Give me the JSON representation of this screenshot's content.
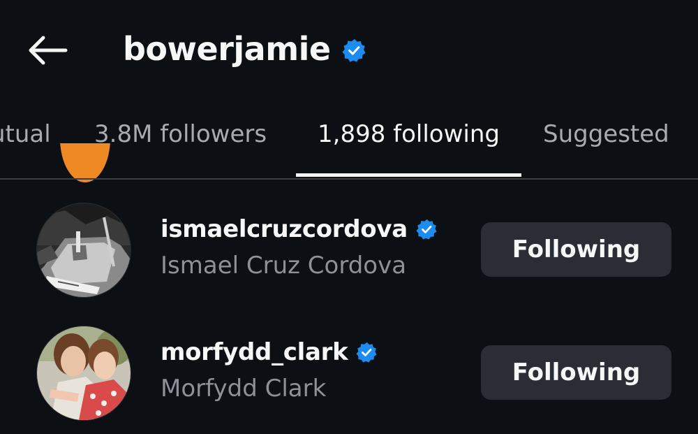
{
  "header": {
    "title": "bowerjamie",
    "verified": true
  },
  "tabs": [
    {
      "label": "mutual",
      "visible_text": "utual",
      "active": false
    },
    {
      "label": "3.8M followers",
      "active": false
    },
    {
      "label": "1,898 following",
      "active": true
    },
    {
      "label": "Suggested",
      "active": false
    }
  ],
  "colors": {
    "background": "#0c0f14",
    "verified": "#1d8cf0",
    "button_bg": "#2a2d34",
    "secondary_text": "#8e9298"
  },
  "following_list": [
    {
      "username": "ismaelcruzcordova",
      "full_name": "Ismael Cruz Cordova",
      "verified": true,
      "button_label": "Following"
    },
    {
      "username": "morfydd_clark",
      "full_name": "Morfydd Clark",
      "verified": true,
      "button_label": "Following"
    }
  ]
}
